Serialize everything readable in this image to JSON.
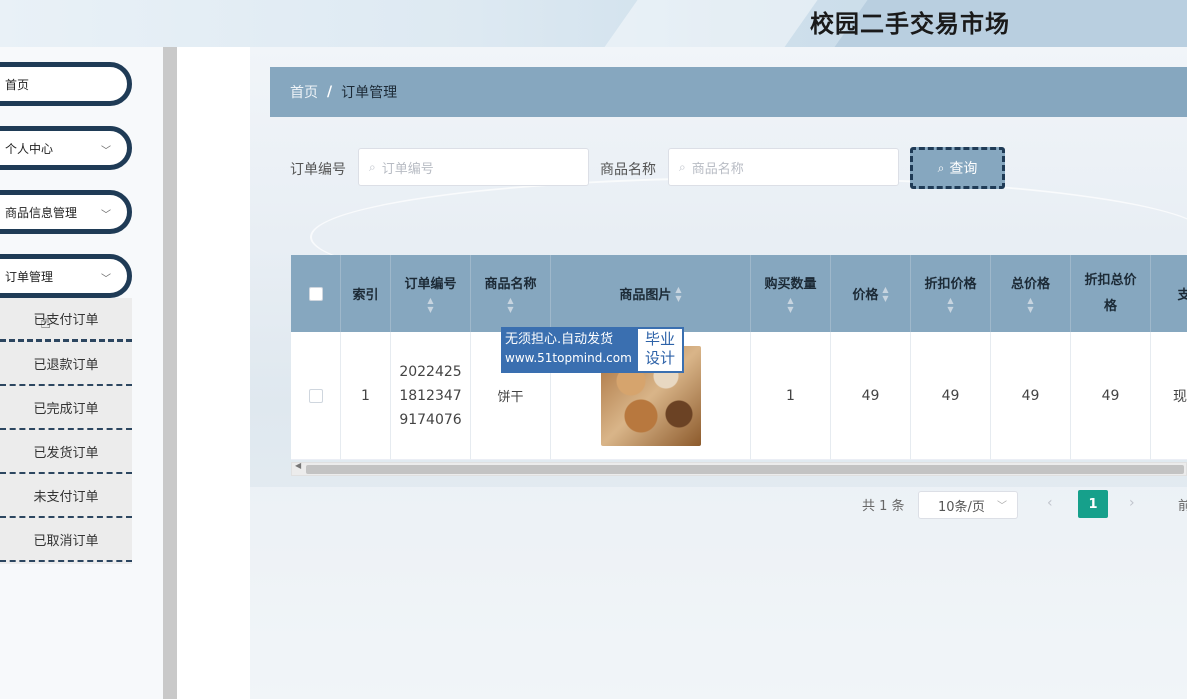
{
  "header": {
    "title": "校园二手交易市场"
  },
  "sidebar": {
    "items": [
      {
        "label": "首页",
        "has_chevron": false
      },
      {
        "label": "个人中心",
        "has_chevron": true
      },
      {
        "label": "商品信息管理",
        "has_chevron": true
      },
      {
        "label": "订单管理",
        "has_chevron": true
      }
    ],
    "submenu": [
      {
        "label": "已支付订单",
        "active": true
      },
      {
        "label": "已退款订单",
        "active": false
      },
      {
        "label": "已完成订单",
        "active": false
      },
      {
        "label": "已发货订单",
        "active": false
      },
      {
        "label": "未支付订单",
        "active": false
      },
      {
        "label": "已取消订单",
        "active": false
      }
    ],
    "chevron_glyph": "﹀"
  },
  "breadcrumb": {
    "home": "首页",
    "separator": "/",
    "current": "订单管理"
  },
  "search": {
    "order_no_label": "订单编号",
    "order_no_placeholder": "订单编号",
    "goods_name_label": "商品名称",
    "goods_name_placeholder": "商品名称",
    "button_label": "查询"
  },
  "table": {
    "columns": [
      "索引",
      "订单编号",
      "商品名称",
      "商品图片",
      "购买数量",
      "价格",
      "折扣价格",
      "总价格",
      "折扣总价格",
      "支付"
    ],
    "rows": [
      {
        "index": "1",
        "order_no_lines": [
          "2022425",
          "1812347",
          "9174076"
        ],
        "goods_name": "饼干",
        "quantity": "1",
        "price": "49",
        "discount_price": "49",
        "total_price": "49",
        "discount_total": "49",
        "payment": "现"
      }
    ]
  },
  "watermark": {
    "line1": "无须担心.自动发货",
    "line2": "www.51topmind.com",
    "right1": "毕业",
    "right2": "设计"
  },
  "pagination": {
    "total": "共 1 条",
    "page_size": "10条/页",
    "current_page": "1",
    "goto": "前"
  },
  "colors": {
    "accent": "#86a7bf",
    "sidebar_border": "#1f3b56",
    "page_active": "#16a08b"
  }
}
